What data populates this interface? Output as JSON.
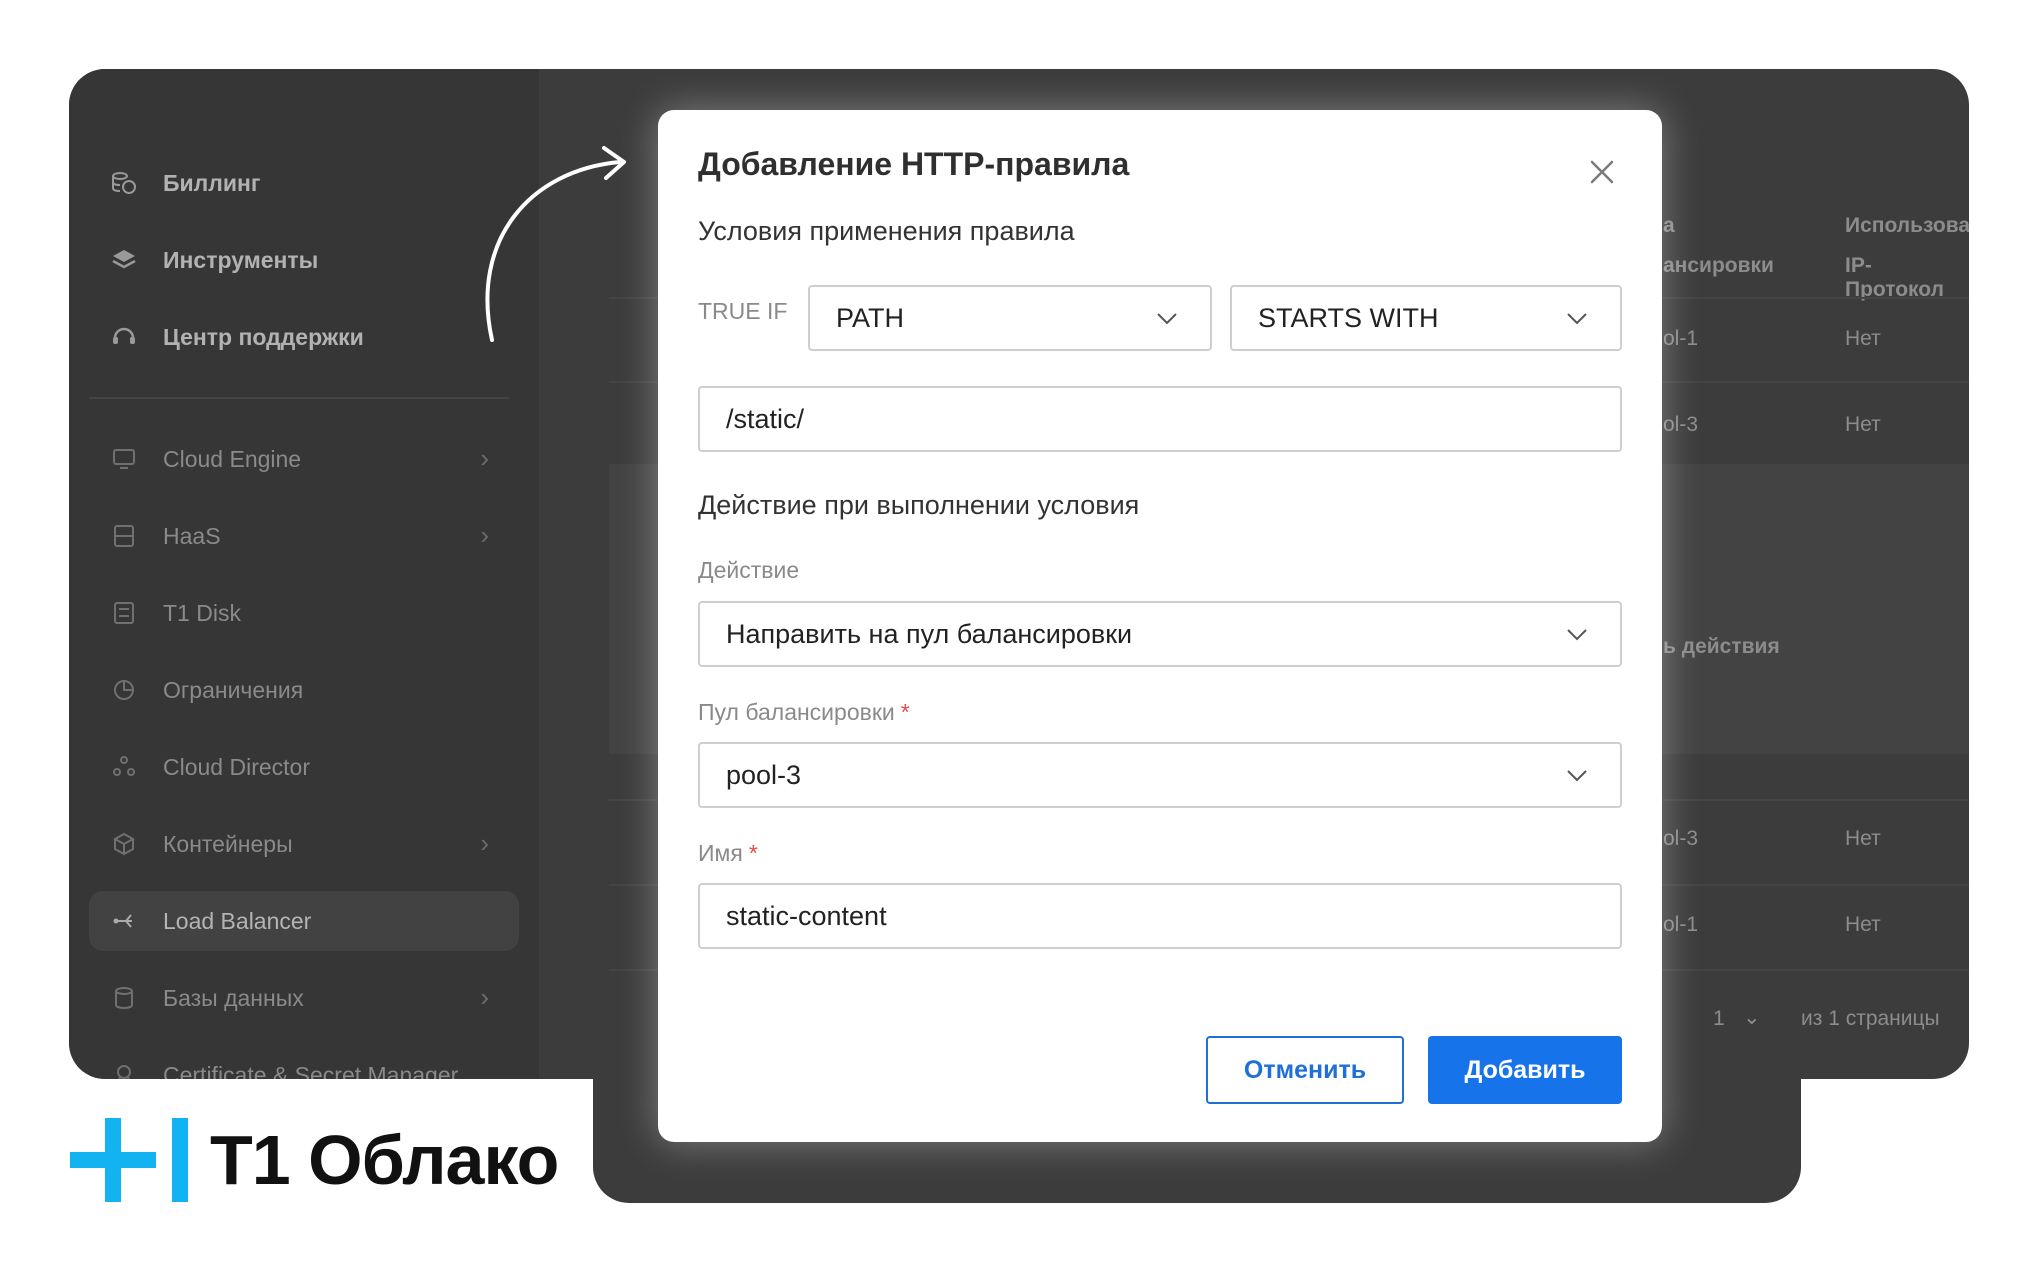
{
  "sidebar": {
    "items": [
      {
        "label": "Биллинг",
        "icon": "coins-icon"
      },
      {
        "label": "Инструменты",
        "icon": "layers-icon"
      },
      {
        "label": "Центр поддержки",
        "icon": "support-icon"
      },
      {
        "label": "Cloud Engine",
        "icon": "monitor-icon",
        "chevron": true
      },
      {
        "label": "HaaS",
        "icon": "server-icon",
        "chevron": true
      },
      {
        "label": "T1 Disk",
        "icon": "disk-icon"
      },
      {
        "label": "Ограничения",
        "icon": "pie-icon"
      },
      {
        "label": "Cloud Director",
        "icon": "director-icon"
      },
      {
        "label": "Контейнеры",
        "icon": "cube-icon",
        "chevron": true
      },
      {
        "label": "Load Balancer",
        "icon": "balancer-icon",
        "active": true
      },
      {
        "label": "Базы данных",
        "icon": "database-icon",
        "chevron": true
      },
      {
        "label": "Certificate & Secret Manager",
        "icon": "certificate-icon"
      }
    ]
  },
  "background": {
    "col_header_1a": "а",
    "col_header_1b": "ансировки",
    "col_header_2a": "Использоват",
    "col_header_2b": "IP-Протокол",
    "rows": [
      {
        "pool": "ol-1",
        "value": "Нет"
      },
      {
        "pool": "ol-3",
        "value": "Нет"
      },
      {
        "pool": "ol-3",
        "value": "Нет"
      },
      {
        "pool": "ol-1",
        "value": "Нет"
      }
    ],
    "action_label": "ь действия",
    "pagination_page": "1",
    "pagination_total": "из 1 страницы"
  },
  "modal": {
    "title": "Добавление HTTP-правила",
    "conditions_title": "Условия применения правила",
    "true_if_label": "TRUE IF",
    "condition_field": "PATH",
    "condition_operator": "STARTS WITH",
    "condition_value": "/static/",
    "action_section_title": "Действие при выполнении условия",
    "action_label": "Действие",
    "action_value": "Направить на пул балансировки",
    "pool_label": "Пул балансировки",
    "pool_value": "pool-3",
    "name_label": "Имя",
    "name_value": "static-content",
    "required_mark": "*",
    "cancel_label": "Отменить",
    "add_label": "Добавить"
  },
  "logo": {
    "text": "T1 Облако"
  },
  "colors": {
    "accent": "#1673ea",
    "logo_cyan": "#12b3f0",
    "required": "#e5484d"
  }
}
